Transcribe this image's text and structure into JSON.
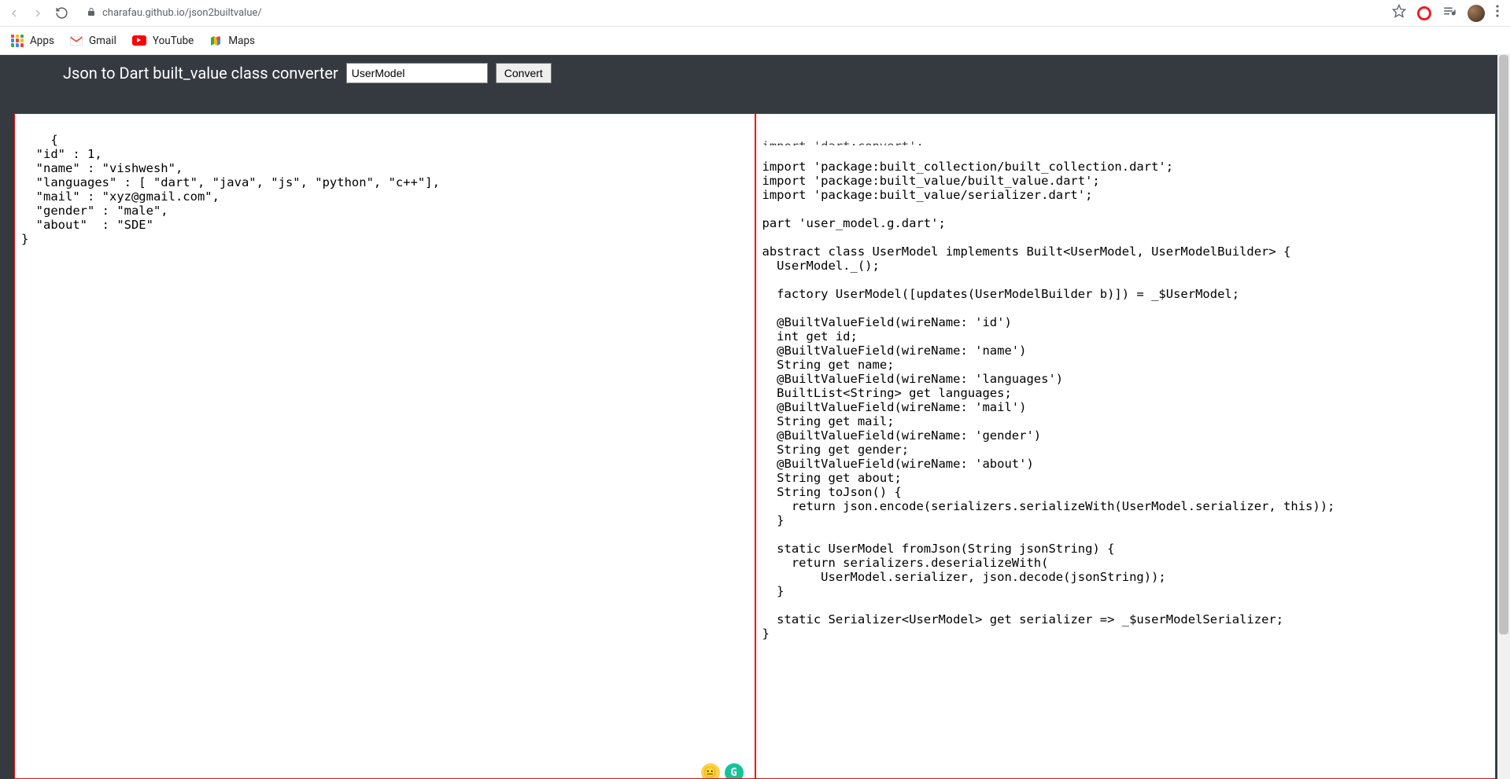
{
  "browser": {
    "url": "charafau.github.io/json2builtvalue/",
    "bookmarks": {
      "apps_label": "Apps",
      "gmail_label": "Gmail",
      "youtube_label": "YouTube",
      "maps_label": "Maps"
    }
  },
  "header": {
    "title": "Json to Dart built_value class converter",
    "class_name_value": "UserModel",
    "convert_label": "Convert"
  },
  "left_pane": {
    "code": "{\n  \"id\" : 1,\n  \"name\" : \"vishwesh\",\n  \"languages\" : [ \"dart\", \"java\", \"js\", \"python\", \"c++\"],\n  \"mail\" : \"xyz@gmail.com\",\n  \"gender\" : \"male\",\n  \"about\"  : \"SDE\"\n}"
  },
  "right_pane": {
    "cutoff_line": "import 'dart:convert';",
    "code": "import 'package:built_collection/built_collection.dart';\nimport 'package:built_value/built_value.dart';\nimport 'package:built_value/serializer.dart';\n\npart 'user_model.g.dart';\n\nabstract class UserModel implements Built<UserModel, UserModelBuilder> {\n  UserModel._();\n\n  factory UserModel([updates(UserModelBuilder b)]) = _$UserModel;\n\n  @BuiltValueField(wireName: 'id')\n  int get id;\n  @BuiltValueField(wireName: 'name')\n  String get name;\n  @BuiltValueField(wireName: 'languages')\n  BuiltList<String> get languages;\n  @BuiltValueField(wireName: 'mail')\n  String get mail;\n  @BuiltValueField(wireName: 'gender')\n  String get gender;\n  @BuiltValueField(wireName: 'about')\n  String get about;\n  String toJson() {\n    return json.encode(serializers.serializeWith(UserModel.serializer, this));\n  }\n\n  static UserModel fromJson(String jsonString) {\n    return serializers.deserializeWith(\n        UserModel.serializer, json.decode(jsonString));\n  }\n\n  static Serializer<UserModel> get serializer => _$userModelSerializer;\n}"
  },
  "floats": {
    "emoji": "😐",
    "grammarly": "G"
  }
}
